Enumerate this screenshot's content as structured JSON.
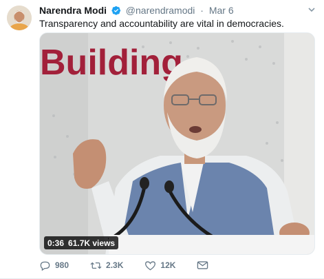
{
  "tweet": {
    "author_name": "Narendra Modi",
    "handle": "@narendramodi",
    "separator": "·",
    "time": "Mar 6",
    "text": "Transparency and accountability are vital in democracies.",
    "media": {
      "background_sign_text": "Building",
      "duration": "0:36",
      "views": "61.7K views"
    },
    "actions": {
      "replies": "980",
      "retweets": "2.3K",
      "likes": "12K"
    }
  },
  "colors": {
    "text": "#14171a",
    "muted": "#657786",
    "verified": "#1da1f2",
    "sign_red": "#a2203a"
  },
  "icons": [
    "verified-badge-icon",
    "chevron-down-icon",
    "reply-icon",
    "retweet-icon",
    "like-icon",
    "direct-message-icon"
  ]
}
